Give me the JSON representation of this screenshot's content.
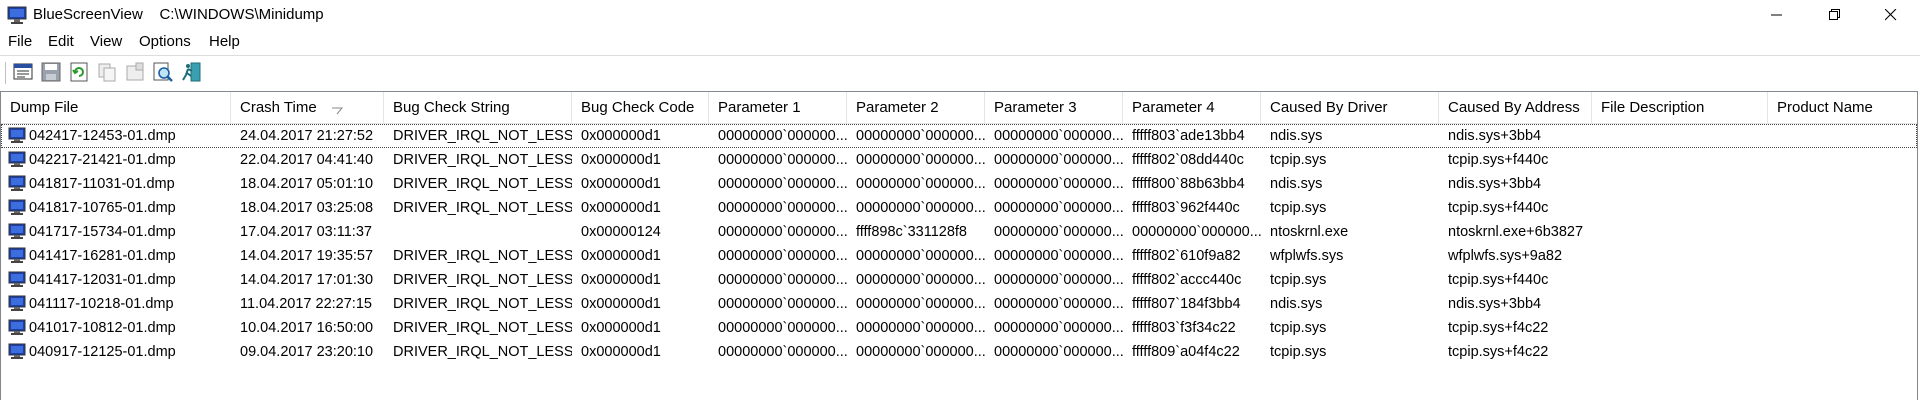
{
  "window": {
    "title": "BlueScreenView    C:\\WINDOWS\\Minidump"
  },
  "menu": [
    "File",
    "Edit",
    "View",
    "Options",
    "Help"
  ],
  "toolbar": [
    "properties-icon",
    "save-icon",
    "refresh-icon",
    "copy-icon",
    "properties-disabled-icon",
    "find-icon",
    "exit-icon"
  ],
  "columns": [
    "Dump File",
    "Crash Time",
    "Bug Check String",
    "Bug Check Code",
    "Parameter 1",
    "Parameter 2",
    "Parameter 3",
    "Parameter 4",
    "Caused By Driver",
    "Caused By Address",
    "File Description",
    "Product Name"
  ],
  "sorted_column": "Crash Time",
  "rows": [
    [
      "042417-12453-01.dmp",
      "24.04.2017 21:27:52",
      "DRIVER_IRQL_NOT_LESS...",
      "0x000000d1",
      "00000000`000000...",
      "00000000`000000...",
      "00000000`000000...",
      "fffff803`ade13bb4",
      "ndis.sys",
      "ndis.sys+3bb4",
      "",
      ""
    ],
    [
      "042217-21421-01.dmp",
      "22.04.2017 04:41:40",
      "DRIVER_IRQL_NOT_LESS...",
      "0x000000d1",
      "00000000`000000...",
      "00000000`000000...",
      "00000000`000000...",
      "fffff802`08dd440c",
      "tcpip.sys",
      "tcpip.sys+f440c",
      "",
      ""
    ],
    [
      "041817-11031-01.dmp",
      "18.04.2017 05:01:10",
      "DRIVER_IRQL_NOT_LESS...",
      "0x000000d1",
      "00000000`000000...",
      "00000000`000000...",
      "00000000`000000...",
      "fffff800`88b63bb4",
      "ndis.sys",
      "ndis.sys+3bb4",
      "",
      ""
    ],
    [
      "041817-10765-01.dmp",
      "18.04.2017 03:25:08",
      "DRIVER_IRQL_NOT_LESS...",
      "0x000000d1",
      "00000000`000000...",
      "00000000`000000...",
      "00000000`000000...",
      "fffff803`962f440c",
      "tcpip.sys",
      "tcpip.sys+f440c",
      "",
      ""
    ],
    [
      "041717-15734-01.dmp",
      "17.04.2017 03:11:37",
      "",
      "0x00000124",
      "00000000`000000...",
      "ffff898c`331128f8",
      "00000000`000000...",
      "00000000`000000...",
      "ntoskrnl.exe",
      "ntoskrnl.exe+6b3827",
      "",
      ""
    ],
    [
      "041417-16281-01.dmp",
      "14.04.2017 19:35:57",
      "DRIVER_IRQL_NOT_LESS...",
      "0x000000d1",
      "00000000`000000...",
      "00000000`000000...",
      "00000000`000000...",
      "fffff802`610f9a82",
      "wfplwfs.sys",
      "wfplwfs.sys+9a82",
      "",
      ""
    ],
    [
      "041417-12031-01.dmp",
      "14.04.2017 17:01:30",
      "DRIVER_IRQL_NOT_LESS...",
      "0x000000d1",
      "00000000`000000...",
      "00000000`000000...",
      "00000000`000000...",
      "fffff802`accc440c",
      "tcpip.sys",
      "tcpip.sys+f440c",
      "",
      ""
    ],
    [
      "041117-10218-01.dmp",
      "11.04.2017 22:27:15",
      "DRIVER_IRQL_NOT_LESS...",
      "0x000000d1",
      "00000000`000000...",
      "00000000`000000...",
      "00000000`000000...",
      "fffff807`184f3bb4",
      "ndis.sys",
      "ndis.sys+3bb4",
      "",
      ""
    ],
    [
      "041017-10812-01.dmp",
      "10.04.2017 16:50:00",
      "DRIVER_IRQL_NOT_LESS...",
      "0x000000d1",
      "00000000`000000...",
      "00000000`000000...",
      "00000000`000000...",
      "fffff803`f3f34c22",
      "tcpip.sys",
      "tcpip.sys+f4c22",
      "",
      ""
    ],
    [
      "040917-12125-01.dmp",
      "09.04.2017 23:20:10",
      "DRIVER_IRQL_NOT_LESS...",
      "0x000000d1",
      "00000000`000000...",
      "00000000`000000...",
      "00000000`000000...",
      "fffff809`a04f4c22",
      "tcpip.sys",
      "tcpip.sys+f4c22",
      "",
      ""
    ]
  ]
}
